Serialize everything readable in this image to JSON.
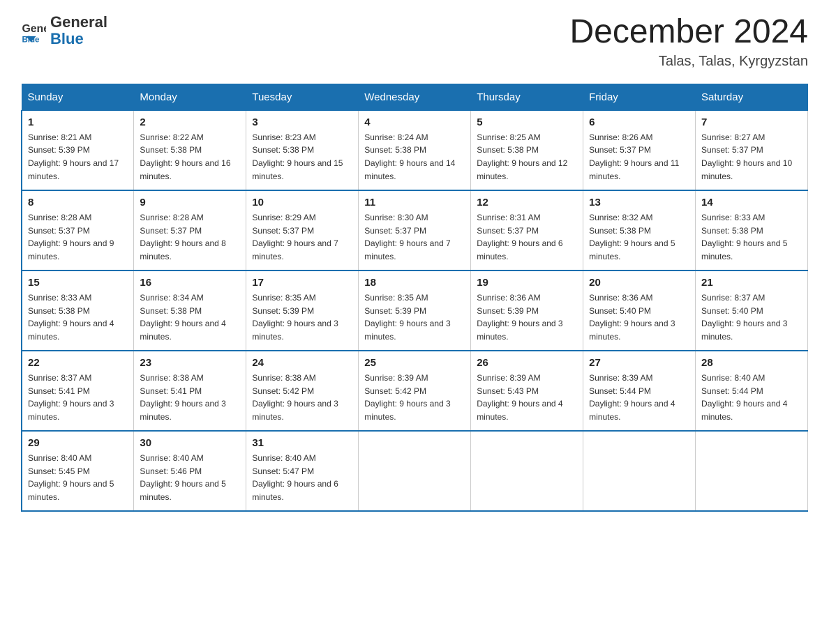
{
  "header": {
    "logo_general": "General",
    "logo_blue": "Blue",
    "month_title": "December 2024",
    "location": "Talas, Talas, Kyrgyzstan"
  },
  "days_of_week": [
    "Sunday",
    "Monday",
    "Tuesday",
    "Wednesday",
    "Thursday",
    "Friday",
    "Saturday"
  ],
  "weeks": [
    [
      {
        "day": "1",
        "sunrise": "8:21 AM",
        "sunset": "5:39 PM",
        "daylight": "9 hours and 17 minutes."
      },
      {
        "day": "2",
        "sunrise": "8:22 AM",
        "sunset": "5:38 PM",
        "daylight": "9 hours and 16 minutes."
      },
      {
        "day": "3",
        "sunrise": "8:23 AM",
        "sunset": "5:38 PM",
        "daylight": "9 hours and 15 minutes."
      },
      {
        "day": "4",
        "sunrise": "8:24 AM",
        "sunset": "5:38 PM",
        "daylight": "9 hours and 14 minutes."
      },
      {
        "day": "5",
        "sunrise": "8:25 AM",
        "sunset": "5:38 PM",
        "daylight": "9 hours and 12 minutes."
      },
      {
        "day": "6",
        "sunrise": "8:26 AM",
        "sunset": "5:37 PM",
        "daylight": "9 hours and 11 minutes."
      },
      {
        "day": "7",
        "sunrise": "8:27 AM",
        "sunset": "5:37 PM",
        "daylight": "9 hours and 10 minutes."
      }
    ],
    [
      {
        "day": "8",
        "sunrise": "8:28 AM",
        "sunset": "5:37 PM",
        "daylight": "9 hours and 9 minutes."
      },
      {
        "day": "9",
        "sunrise": "8:28 AM",
        "sunset": "5:37 PM",
        "daylight": "9 hours and 8 minutes."
      },
      {
        "day": "10",
        "sunrise": "8:29 AM",
        "sunset": "5:37 PM",
        "daylight": "9 hours and 7 minutes."
      },
      {
        "day": "11",
        "sunrise": "8:30 AM",
        "sunset": "5:37 PM",
        "daylight": "9 hours and 7 minutes."
      },
      {
        "day": "12",
        "sunrise": "8:31 AM",
        "sunset": "5:37 PM",
        "daylight": "9 hours and 6 minutes."
      },
      {
        "day": "13",
        "sunrise": "8:32 AM",
        "sunset": "5:38 PM",
        "daylight": "9 hours and 5 minutes."
      },
      {
        "day": "14",
        "sunrise": "8:33 AM",
        "sunset": "5:38 PM",
        "daylight": "9 hours and 5 minutes."
      }
    ],
    [
      {
        "day": "15",
        "sunrise": "8:33 AM",
        "sunset": "5:38 PM",
        "daylight": "9 hours and 4 minutes."
      },
      {
        "day": "16",
        "sunrise": "8:34 AM",
        "sunset": "5:38 PM",
        "daylight": "9 hours and 4 minutes."
      },
      {
        "day": "17",
        "sunrise": "8:35 AM",
        "sunset": "5:39 PM",
        "daylight": "9 hours and 3 minutes."
      },
      {
        "day": "18",
        "sunrise": "8:35 AM",
        "sunset": "5:39 PM",
        "daylight": "9 hours and 3 minutes."
      },
      {
        "day": "19",
        "sunrise": "8:36 AM",
        "sunset": "5:39 PM",
        "daylight": "9 hours and 3 minutes."
      },
      {
        "day": "20",
        "sunrise": "8:36 AM",
        "sunset": "5:40 PM",
        "daylight": "9 hours and 3 minutes."
      },
      {
        "day": "21",
        "sunrise": "8:37 AM",
        "sunset": "5:40 PM",
        "daylight": "9 hours and 3 minutes."
      }
    ],
    [
      {
        "day": "22",
        "sunrise": "8:37 AM",
        "sunset": "5:41 PM",
        "daylight": "9 hours and 3 minutes."
      },
      {
        "day": "23",
        "sunrise": "8:38 AM",
        "sunset": "5:41 PM",
        "daylight": "9 hours and 3 minutes."
      },
      {
        "day": "24",
        "sunrise": "8:38 AM",
        "sunset": "5:42 PM",
        "daylight": "9 hours and 3 minutes."
      },
      {
        "day": "25",
        "sunrise": "8:39 AM",
        "sunset": "5:42 PM",
        "daylight": "9 hours and 3 minutes."
      },
      {
        "day": "26",
        "sunrise": "8:39 AM",
        "sunset": "5:43 PM",
        "daylight": "9 hours and 4 minutes."
      },
      {
        "day": "27",
        "sunrise": "8:39 AM",
        "sunset": "5:44 PM",
        "daylight": "9 hours and 4 minutes."
      },
      {
        "day": "28",
        "sunrise": "8:40 AM",
        "sunset": "5:44 PM",
        "daylight": "9 hours and 4 minutes."
      }
    ],
    [
      {
        "day": "29",
        "sunrise": "8:40 AM",
        "sunset": "5:45 PM",
        "daylight": "9 hours and 5 minutes."
      },
      {
        "day": "30",
        "sunrise": "8:40 AM",
        "sunset": "5:46 PM",
        "daylight": "9 hours and 5 minutes."
      },
      {
        "day": "31",
        "sunrise": "8:40 AM",
        "sunset": "5:47 PM",
        "daylight": "9 hours and 6 minutes."
      },
      null,
      null,
      null,
      null
    ]
  ]
}
